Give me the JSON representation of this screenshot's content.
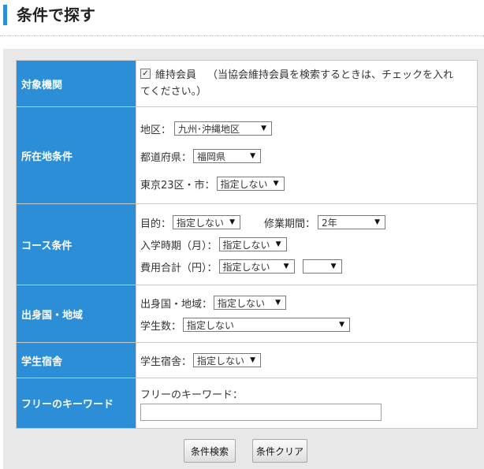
{
  "page": {
    "title": "条件で探す"
  },
  "rows": {
    "target": {
      "header": "対象機関",
      "checkbox_checked": true,
      "checkbox_label": "維持会員",
      "note_line1": "（当協会維持会員を検索するときは、チェックを入れ",
      "note_line2": "てください。）"
    },
    "location": {
      "header": "所在地条件",
      "region_label": "地区：",
      "region_value": "九州･沖縄地区",
      "prefecture_label": "都道府県：",
      "prefecture_value": "福岡県",
      "tokyo_label": "東京23区・市：",
      "tokyo_value": "指定しない"
    },
    "course": {
      "header": "コース条件",
      "purpose_label": "目的：",
      "purpose_value": "指定しない",
      "period_label": "修業期間：",
      "period_value": "2年",
      "entry_label": "入学時期（月）：",
      "entry_value": "指定しない",
      "cost_label": "費用合計（円）：",
      "cost_value": "指定しない",
      "cost_value2": ""
    },
    "origin": {
      "header": "出身国・地域",
      "country_label": "出身国・地域：",
      "country_value": "指定しない",
      "students_label": "学生数：",
      "students_value": "指定しない"
    },
    "dorm": {
      "header": "学生宿舎",
      "dorm_label": "学生宿舎：",
      "dorm_value": "指定しない"
    },
    "keyword": {
      "header": "フリーのキーワード",
      "keyword_label": "フリーのキーワード：",
      "keyword_value": ""
    }
  },
  "buttons": {
    "search": "条件検索",
    "clear": "条件クリア"
  },
  "colors": {
    "accent": "#2b8ed6",
    "panel": "#e8e8e8"
  }
}
